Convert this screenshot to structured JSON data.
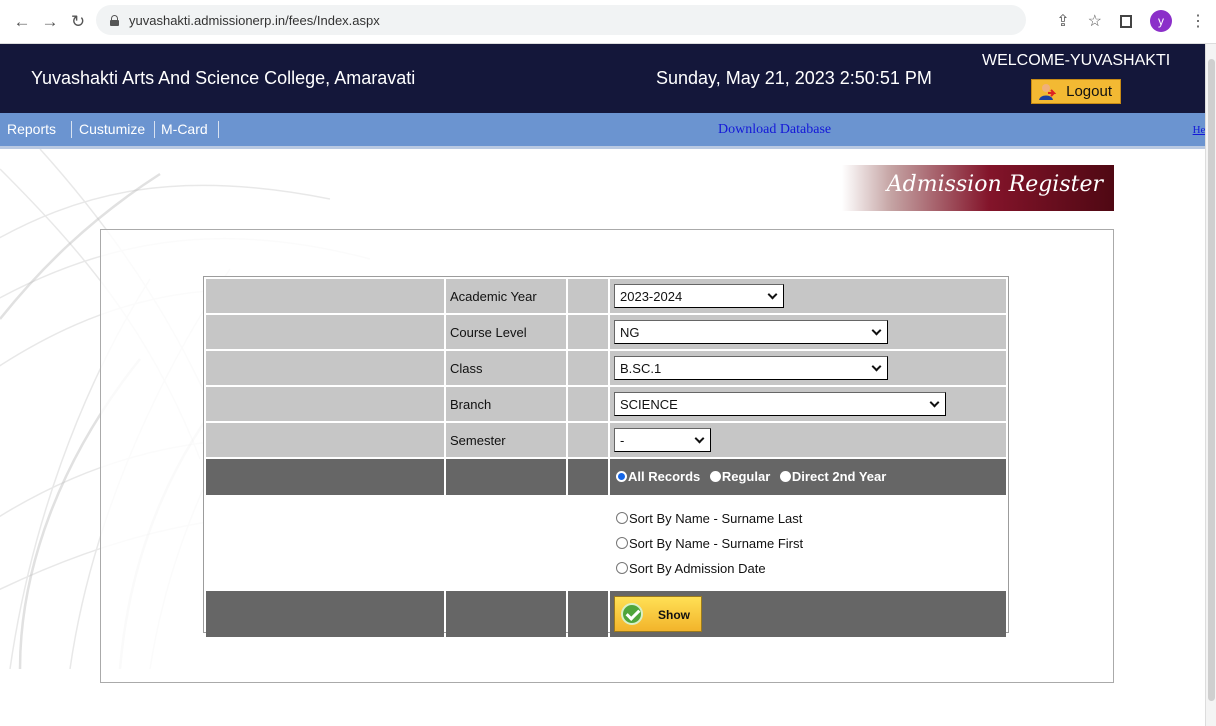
{
  "browser": {
    "url": "yuvashakti.admissionerp.in/fees/Index.aspx",
    "avatar_letter": "y",
    "icons": [
      "back-icon",
      "forward-icon",
      "reload-icon",
      "lock-icon",
      "share-icon",
      "star-icon",
      "window-icon",
      "profile-icon",
      "more-icon"
    ]
  },
  "header": {
    "college_name": "Yuvashakti Arts And Science College, Amaravati",
    "datetime": "Sunday, May 21, 2023 2:50:51 PM",
    "welcome": "WELCOME-YUVASHAKTI",
    "logout_label": "Logout"
  },
  "menu": {
    "items": [
      "Reports",
      "Custumize",
      "M-Card"
    ],
    "download_label": "Download Database",
    "help_label": "Help"
  },
  "page": {
    "title": "Admission Register"
  },
  "form": {
    "academic_year": {
      "label": "Academic Year",
      "value": "2023-2024"
    },
    "course_level": {
      "label": "Course Level",
      "value": "NG"
    },
    "class": {
      "label": "Class",
      "value": "B.SC.1"
    },
    "branch": {
      "label": "Branch",
      "value": "SCIENCE"
    },
    "semester": {
      "label": "Semester",
      "value": "-"
    },
    "record_filter": [
      {
        "label": "All Records",
        "selected": true
      },
      {
        "label": "Regular",
        "selected": false
      },
      {
        "label": "Direct 2nd Year",
        "selected": false
      }
    ],
    "sort_options": [
      "Sort By Name - Surname Last",
      "Sort By Name - Surname First",
      "Sort By Admission Date"
    ],
    "show_label": "Show"
  },
  "colors": {
    "header_bg": "#14173a",
    "menu_bg": "#6b94d0",
    "banner": "#83142a",
    "table_light": "#c6c6c6",
    "table_dark": "#666666",
    "button": "#f3b933"
  }
}
